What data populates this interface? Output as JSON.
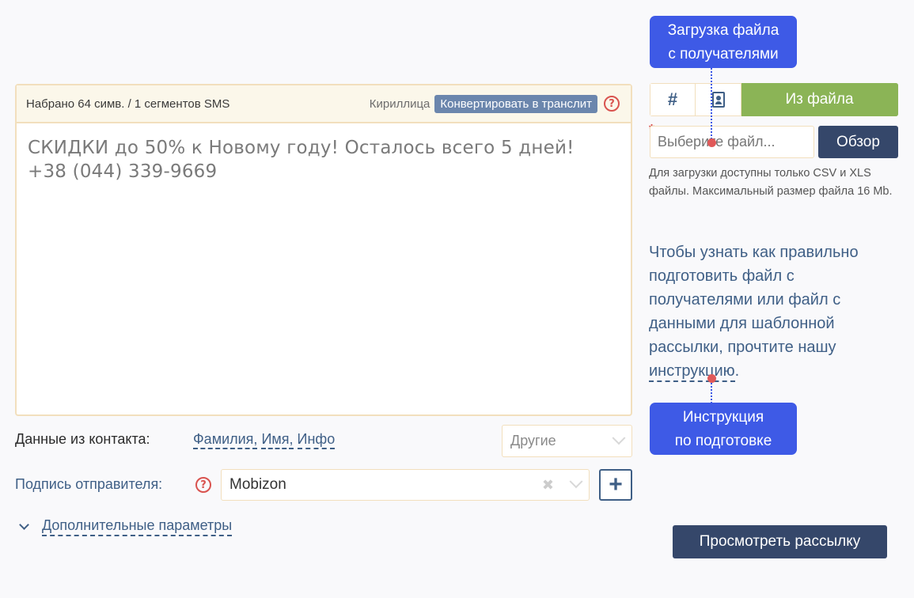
{
  "message": {
    "counter": "Набрано 64 симв. / 1 сегментов SMS",
    "alphabet": "Кириллица",
    "convert_label": "Конвертировать в транслит",
    "help_glyph": "?",
    "lines": [
      "СКИДКИ до 50% к Новому году! Осталось всего 5 дней!",
      "+38 (044) 339-9669"
    ]
  },
  "contact_data": {
    "label": "Данные из контакта:",
    "links": [
      "Фамилия,",
      "Имя,",
      "Инфо"
    ],
    "others_placeholder": "Другие"
  },
  "sender": {
    "label": "Подпись отправителя:",
    "value": "Mobizon",
    "clear_glyph": "✖",
    "add_glyph": "+"
  },
  "extra_params_label": "Дополнительные параметры",
  "recipients": {
    "toggle_hash": "#",
    "toggle_file": "Из файла",
    "file_placeholder": "Выберите файл...",
    "required_mark": "*",
    "browse_label": "Обзор",
    "hint": "Для загрузки доступны только CSV и XLS файлы. Максимальный размер файла 16 Mb.",
    "instruction_text": "Чтобы узнать как правильно подготовить файл с получателями или файл с данными для шаблонной рассылки, прочтите нашу",
    "instruction_link": "инструкцию",
    "instruction_end": "."
  },
  "preview_label": "Просмотреть рассылку",
  "callouts": {
    "upload_line1": "Загрузка файла",
    "upload_line2": "с получателями",
    "instr_line1": "Инструкция",
    "instr_line2": "по подготовке"
  },
  "colors": {
    "accent_dark": "#35476a",
    "link": "#3f5f86",
    "active_green": "#8bb456",
    "callout_blue": "#3e5ae6",
    "help_red": "#d9534f"
  }
}
